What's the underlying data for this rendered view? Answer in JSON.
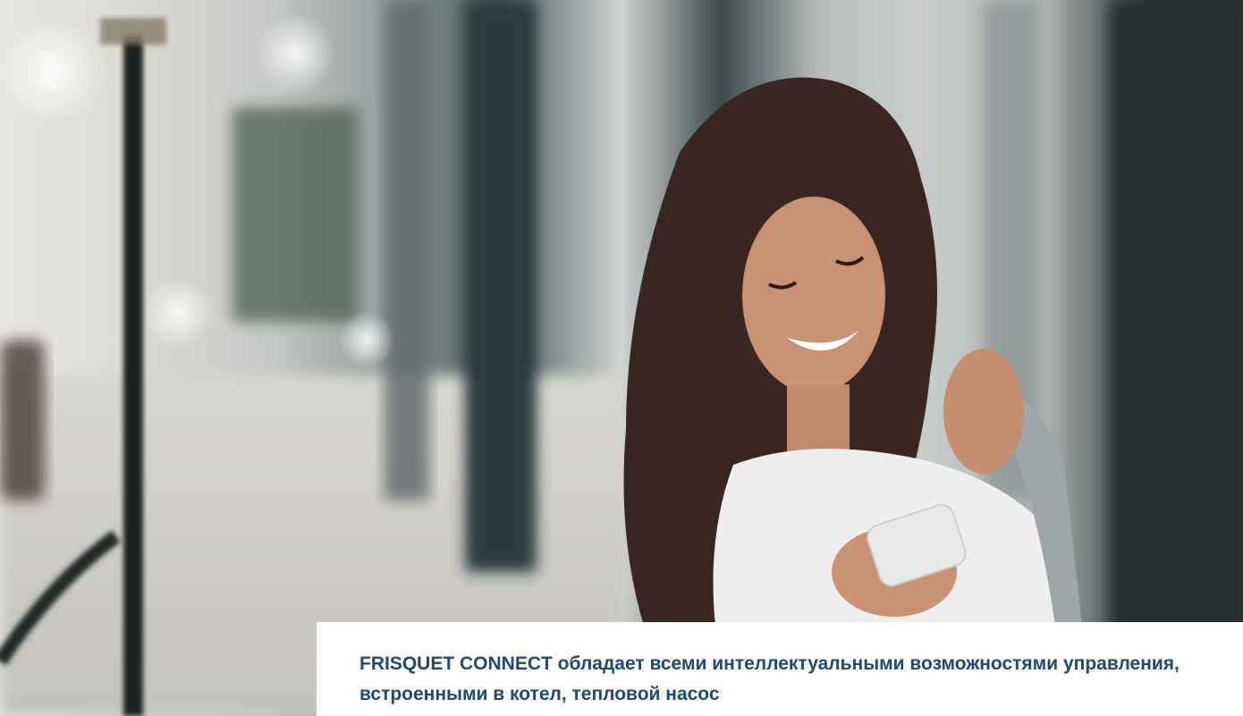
{
  "hero": {
    "image": "woman-smiling-at-phone-photo"
  },
  "caption": {
    "text": "FRISQUET CONNECT обладает всеми интеллектуальными возможностями управления, встроенными в котел, тепловой насос"
  },
  "colors": {
    "caption_text": "#1f4a6e",
    "panel_bg": "#ffffff"
  }
}
